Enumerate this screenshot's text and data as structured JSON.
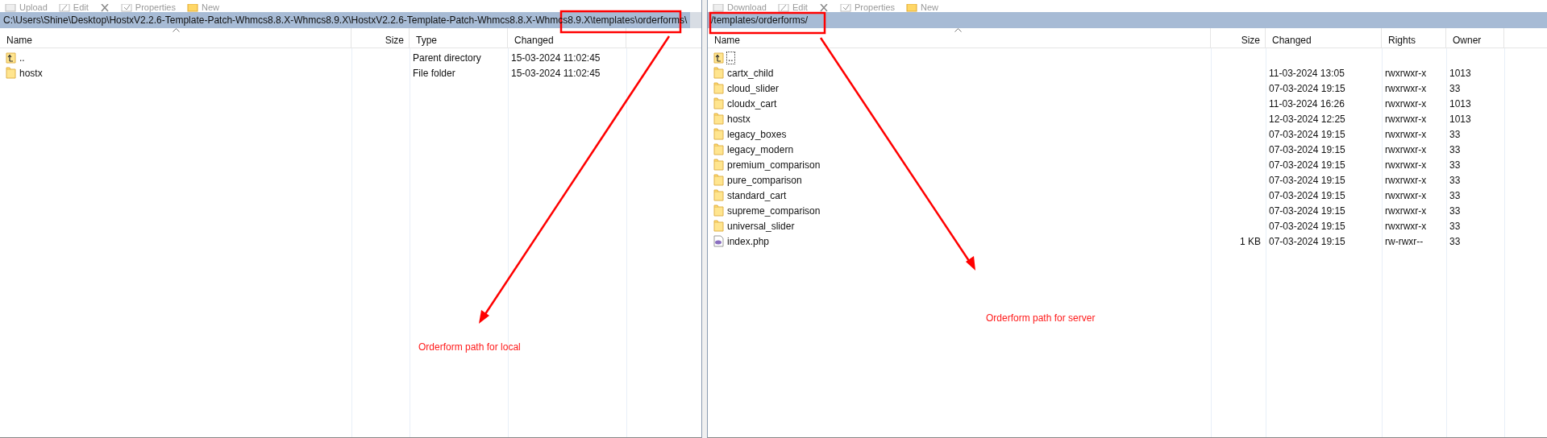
{
  "toolbars": [
    {
      "items": [
        {
          "label": "Upload",
          "kind": "upload"
        },
        {
          "label": "Edit",
          "kind": "edit"
        },
        {
          "label": "Properties",
          "kind": "properties"
        },
        {
          "label": "New",
          "kind": "new"
        }
      ]
    },
    {
      "items": [
        {
          "label": "Download",
          "kind": "download"
        },
        {
          "label": "Edit",
          "kind": "edit"
        },
        {
          "label": "Properties",
          "kind": "properties"
        },
        {
          "label": "New",
          "kind": "new"
        }
      ]
    }
  ],
  "local_panel": {
    "path": "C:\\Users\\Shine\\Desktop\\HostxV2.2.6-Template-Patch-Whmcs8.8.X-Whmcs8.9.X\\HostxV2.2.6-Template-Patch-Whmcs8.8.X-Whmcs8.9.X\\templates\\orderforms\\",
    "columns": [
      "Name",
      "Size",
      "Type",
      "Changed"
    ],
    "rows": [
      {
        "kind": "parent",
        "name": "..",
        "type": "Parent directory",
        "changed": "15-03-2024 11:02:45"
      },
      {
        "kind": "folder",
        "name": "hostx",
        "type": "File folder",
        "changed": "15-03-2024 11:02:45"
      }
    ]
  },
  "remote_panel": {
    "path": "/templates/orderforms/",
    "columns": [
      "Name",
      "Size",
      "Changed",
      "Rights",
      "Owner"
    ],
    "rows": [
      {
        "kind": "parent",
        "name": "..",
        "focused": true
      },
      {
        "kind": "folder",
        "name": "cartx_child",
        "changed": "11-03-2024 13:05",
        "rights": "rwxrwxr-x",
        "owner": "1013",
        "focused": false
      },
      {
        "kind": "folder",
        "name": "cloud_slider",
        "changed": "07-03-2024 19:15",
        "rights": "rwxrwxr-x",
        "owner": "33",
        "focused": false
      },
      {
        "kind": "folder",
        "name": "cloudx_cart",
        "changed": "11-03-2024 16:26",
        "rights": "rwxrwxr-x",
        "owner": "1013",
        "focused": false
      },
      {
        "kind": "folder",
        "name": "hostx",
        "changed": "12-03-2024 12:25",
        "rights": "rwxrwxr-x",
        "owner": "1013",
        "focused": false
      },
      {
        "kind": "folder",
        "name": "legacy_boxes",
        "changed": "07-03-2024 19:15",
        "rights": "rwxrwxr-x",
        "owner": "33",
        "focused": false
      },
      {
        "kind": "folder",
        "name": "legacy_modern",
        "changed": "07-03-2024 19:15",
        "rights": "rwxrwxr-x",
        "owner": "33",
        "focused": false
      },
      {
        "kind": "folder",
        "name": "premium_comparison",
        "changed": "07-03-2024 19:15",
        "rights": "rwxrwxr-x",
        "owner": "33",
        "focused": false
      },
      {
        "kind": "folder",
        "name": "pure_comparison",
        "changed": "07-03-2024 19:15",
        "rights": "rwxrwxr-x",
        "owner": "33",
        "focused": false
      },
      {
        "kind": "folder",
        "name": "standard_cart",
        "changed": "07-03-2024 19:15",
        "rights": "rwxrwxr-x",
        "owner": "33",
        "focused": false
      },
      {
        "kind": "folder",
        "name": "supreme_comparison",
        "changed": "07-03-2024 19:15",
        "rights": "rwxrwxr-x",
        "owner": "33",
        "focused": false
      },
      {
        "kind": "folder",
        "name": "universal_slider",
        "changed": "07-03-2024 19:15",
        "rights": "rwxrwxr-x",
        "owner": "33",
        "focused": false
      },
      {
        "kind": "file",
        "name": "index.php",
        "size": "1 KB",
        "changed": "07-03-2024 19:15",
        "rights": "rw-rwxr--",
        "owner": "33",
        "focused": false
      }
    ]
  },
  "annotations": [
    {
      "text": "Orderform path for local"
    },
    {
      "text": "Orderform path for server"
    }
  ]
}
